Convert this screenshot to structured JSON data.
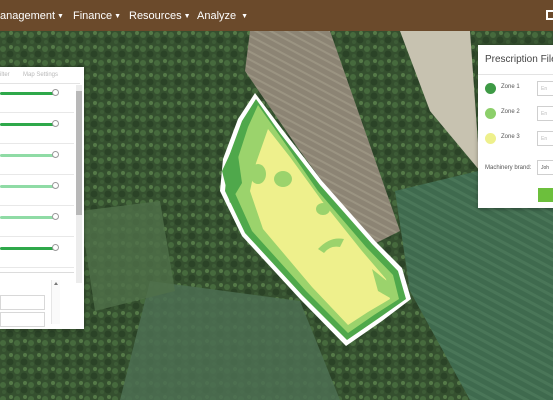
{
  "nav": {
    "items": [
      {
        "label": "anagement"
      },
      {
        "label": "Finance"
      },
      {
        "label": "Resources"
      },
      {
        "label": "Analyze"
      }
    ]
  },
  "left_panel": {
    "tabs": [
      "ilter",
      "Map Settings"
    ],
    "sliders": [
      {
        "level": 1.0,
        "color": "#2ea84a"
      },
      {
        "level": 1.0,
        "color": "#2ea84a"
      },
      {
        "level": 1.0,
        "color": "#8fdba5"
      },
      {
        "level": 1.0,
        "color": "#8fdba5"
      },
      {
        "level": 1.0,
        "color": "#8fdba5"
      },
      {
        "level": 1.0,
        "color": "#2ea84a"
      }
    ]
  },
  "prescription_panel": {
    "title": "Prescription File",
    "zones": [
      {
        "label": "Zone 1",
        "color": "#3e9a45",
        "placeholder": "En"
      },
      {
        "label": "Zone 2",
        "color": "#8ccf6a",
        "placeholder": "En"
      },
      {
        "label": "Zone 3",
        "color": "#eef08c",
        "placeholder": "En"
      }
    ],
    "brand_label": "Machinery brand:",
    "brand_value": "Joh"
  },
  "map": {
    "zone_colors": {
      "zone1": "#4fa84b",
      "zone2": "#9bd36c",
      "zone3": "#eef08c"
    }
  }
}
